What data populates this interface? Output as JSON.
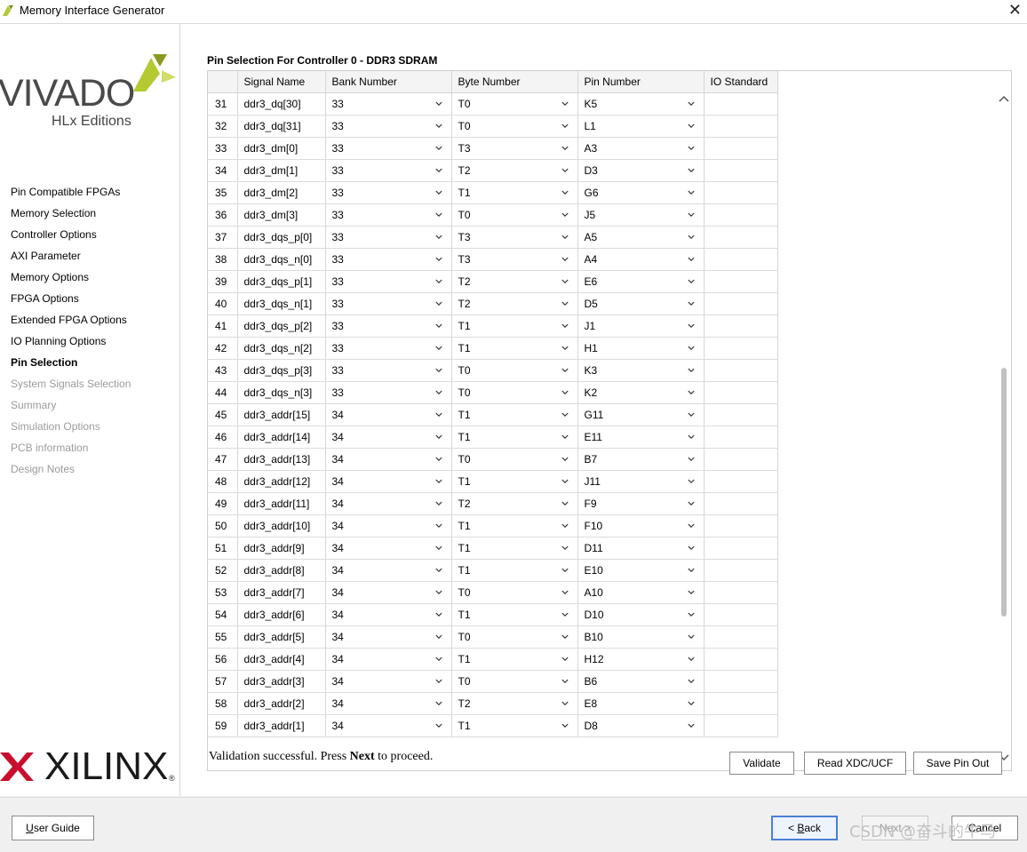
{
  "window": {
    "title": "Memory Interface Generator",
    "close_glyph": "✕"
  },
  "logos": {
    "vivado": "VIVADO",
    "hlx": "HLx Editions",
    "xilinx": "XILINX",
    "xilinx_reg": "®"
  },
  "sidebar": {
    "items": [
      {
        "label": "Pin Compatible FPGAs",
        "state": "normal"
      },
      {
        "label": "Memory Selection",
        "state": "normal"
      },
      {
        "label": "Controller Options",
        "state": "normal"
      },
      {
        "label": "AXI Parameter",
        "state": "normal"
      },
      {
        "label": "Memory Options",
        "state": "normal"
      },
      {
        "label": "FPGA Options",
        "state": "normal"
      },
      {
        "label": "Extended FPGA Options",
        "state": "normal"
      },
      {
        "label": "IO Planning Options",
        "state": "normal"
      },
      {
        "label": "Pin Selection",
        "state": "active"
      },
      {
        "label": "System Signals Selection",
        "state": "disabled"
      },
      {
        "label": "Summary",
        "state": "disabled"
      },
      {
        "label": "Simulation Options",
        "state": "disabled"
      },
      {
        "label": "PCB information",
        "state": "disabled"
      },
      {
        "label": "Design Notes",
        "state": "disabled"
      }
    ]
  },
  "main": {
    "section_title": "Pin Selection For Controller 0 - DDR3 SDRAM",
    "table": {
      "columns": [
        "",
        "Signal Name",
        "Bank Number",
        "Byte Number",
        "Pin Number",
        "IO Standard"
      ],
      "rows": [
        [
          "31",
          "ddr3_dq[30]",
          "33",
          "T0",
          "K5"
        ],
        [
          "32",
          "ddr3_dq[31]",
          "33",
          "T0",
          "L1"
        ],
        [
          "33",
          "ddr3_dm[0]",
          "33",
          "T3",
          "A3"
        ],
        [
          "34",
          "ddr3_dm[1]",
          "33",
          "T2",
          "D3"
        ],
        [
          "35",
          "ddr3_dm[2]",
          "33",
          "T1",
          "G6"
        ],
        [
          "36",
          "ddr3_dm[3]",
          "33",
          "T0",
          "J5"
        ],
        [
          "37",
          "ddr3_dqs_p[0]",
          "33",
          "T3",
          "A5"
        ],
        [
          "38",
          "ddr3_dqs_n[0]",
          "33",
          "T3",
          "A4"
        ],
        [
          "39",
          "ddr3_dqs_p[1]",
          "33",
          "T2",
          "E6"
        ],
        [
          "40",
          "ddr3_dqs_n[1]",
          "33",
          "T2",
          "D5"
        ],
        [
          "41",
          "ddr3_dqs_p[2]",
          "33",
          "T1",
          "J1"
        ],
        [
          "42",
          "ddr3_dqs_n[2]",
          "33",
          "T1",
          "H1"
        ],
        [
          "43",
          "ddr3_dqs_p[3]",
          "33",
          "T0",
          "K3"
        ],
        [
          "44",
          "ddr3_dqs_n[3]",
          "33",
          "T0",
          "K2"
        ],
        [
          "45",
          "ddr3_addr[15]",
          "34",
          "T1",
          "G11"
        ],
        [
          "46",
          "ddr3_addr[14]",
          "34",
          "T1",
          "E11"
        ],
        [
          "47",
          "ddr3_addr[13]",
          "34",
          "T0",
          "B7"
        ],
        [
          "48",
          "ddr3_addr[12]",
          "34",
          "T1",
          "J11"
        ],
        [
          "49",
          "ddr3_addr[11]",
          "34",
          "T2",
          "F9"
        ],
        [
          "50",
          "ddr3_addr[10]",
          "34",
          "T1",
          "F10"
        ],
        [
          "51",
          "ddr3_addr[9]",
          "34",
          "T1",
          "D11"
        ],
        [
          "52",
          "ddr3_addr[8]",
          "34",
          "T1",
          "E10"
        ],
        [
          "53",
          "ddr3_addr[7]",
          "34",
          "T0",
          "A10"
        ],
        [
          "54",
          "ddr3_addr[6]",
          "34",
          "T1",
          "D10"
        ],
        [
          "55",
          "ddr3_addr[5]",
          "34",
          "T0",
          "B10"
        ],
        [
          "56",
          "ddr3_addr[4]",
          "34",
          "T1",
          "H12"
        ],
        [
          "57",
          "ddr3_addr[3]",
          "34",
          "T0",
          "B6"
        ],
        [
          "58",
          "ddr3_addr[2]",
          "34",
          "T2",
          "E8"
        ],
        [
          "59",
          "ddr3_addr[1]",
          "34",
          "T1",
          "D8"
        ]
      ]
    },
    "status_prefix": "Validation successful. Press ",
    "status_bold": "Next",
    "status_suffix": " to proceed.",
    "buttons": {
      "validate": "Validate",
      "read_xdc": "Read XDC/UCF",
      "save_pin": "Save Pin Out"
    }
  },
  "footer": {
    "user_guide_key": "U",
    "user_guide_rest": "ser Guide",
    "back_prefix": "< ",
    "back_key": "B",
    "back_rest": "ack",
    "next_label": "Next >",
    "cancel_label": "Cancel"
  },
  "watermark": "CSDN @奋斗的牛马",
  "colors": {
    "vivado_mark": "#b5c933",
    "xilinx_mark": "#c8102e",
    "back_border": "#4a7fd4"
  }
}
